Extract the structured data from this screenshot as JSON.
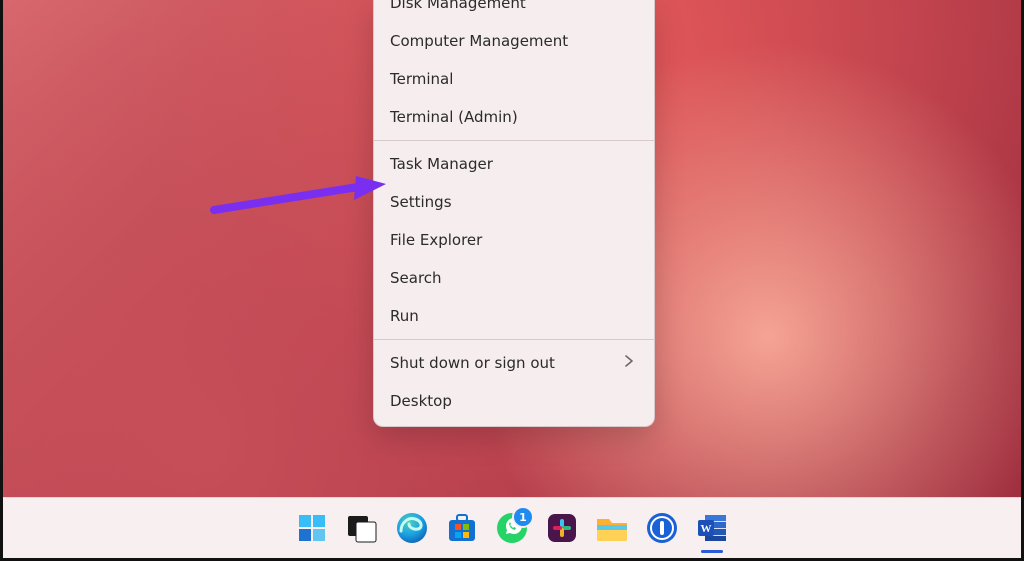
{
  "menu": {
    "group1": [
      "Disk Management",
      "Computer Management",
      "Terminal",
      "Terminal (Admin)"
    ],
    "group2": [
      "Task Manager",
      "Settings",
      "File Explorer",
      "Search",
      "Run"
    ],
    "group3": [
      {
        "label": "Shut down or sign out",
        "submenu": true
      },
      {
        "label": "Desktop",
        "submenu": false
      }
    ]
  },
  "annotation": {
    "points_to": "Task Manager",
    "color": "#7a2ff0"
  },
  "taskbar": {
    "items": [
      {
        "id": "start",
        "name": "start-icon"
      },
      {
        "id": "taskview",
        "name": "task-view-icon"
      },
      {
        "id": "edge",
        "name": "edge-icon"
      },
      {
        "id": "store",
        "name": "microsoft-store-icon"
      },
      {
        "id": "whatsapp",
        "name": "whatsapp-icon",
        "badge": "1"
      },
      {
        "id": "slack",
        "name": "slack-icon"
      },
      {
        "id": "explorer",
        "name": "file-explorer-icon"
      },
      {
        "id": "onepassword",
        "name": "1password-icon"
      },
      {
        "id": "word",
        "name": "word-icon",
        "active": true
      }
    ]
  }
}
